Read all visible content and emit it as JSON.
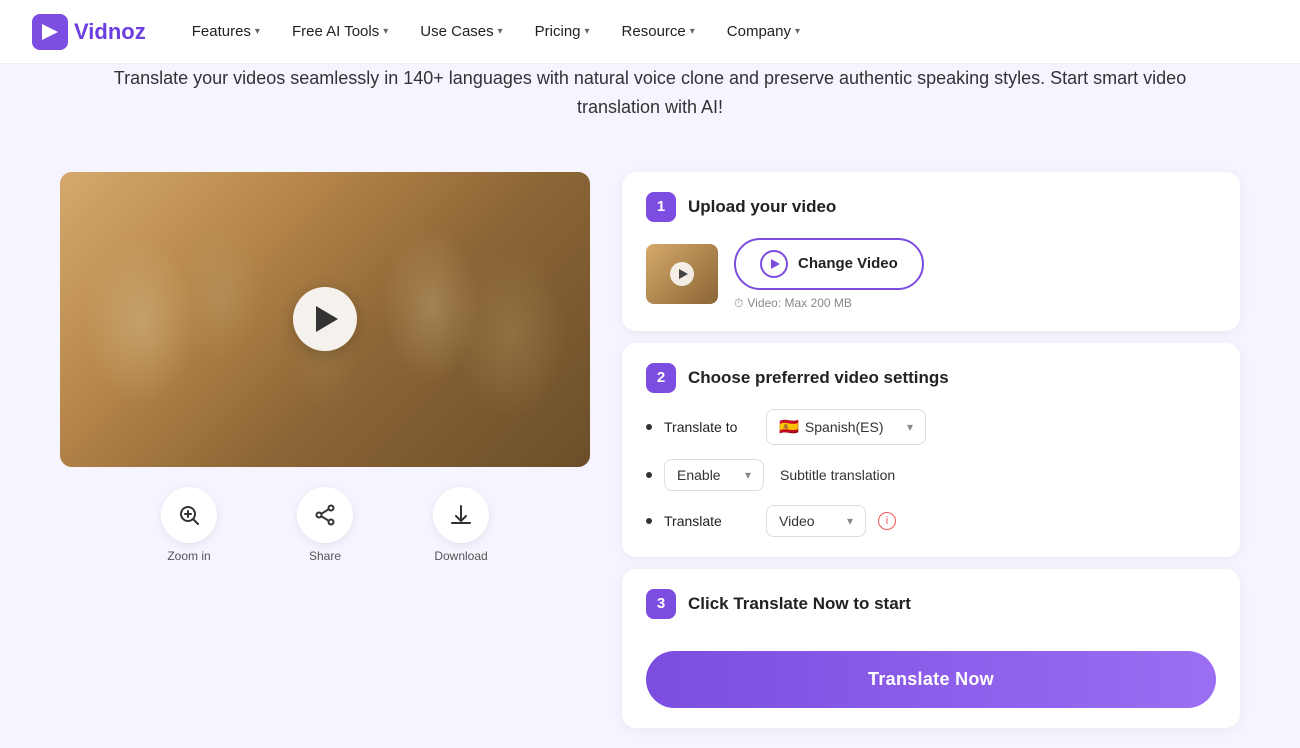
{
  "brand": {
    "name": "Vidnoz",
    "logo_letter": "V"
  },
  "nav": {
    "items": [
      {
        "label": "Features",
        "has_dropdown": true
      },
      {
        "label": "Free AI Tools",
        "has_dropdown": true
      },
      {
        "label": "Use Cases",
        "has_dropdown": true
      },
      {
        "label": "Pricing",
        "has_dropdown": true
      },
      {
        "label": "Resource",
        "has_dropdown": true
      },
      {
        "label": "Company",
        "has_dropdown": true
      }
    ]
  },
  "hero": {
    "subtitle": "Translate your videos seamlessly in 140+ languages with natural voice clone and preserve authentic speaking styles. Start smart video translation with AI!"
  },
  "steps": {
    "step1": {
      "number": "1",
      "title": "Upload your video",
      "change_video_label": "Change Video",
      "video_limit": "Video: Max 200 MB"
    },
    "step2": {
      "number": "2",
      "title": "Choose preferred video settings",
      "translate_to_label": "Translate to",
      "language": "Spanish(ES)",
      "language_flag": "🇪🇸",
      "enable_label": "Enable",
      "subtitle_label": "Subtitle translation",
      "translate_label": "Translate",
      "video_type": "Video"
    },
    "step3": {
      "number": "3",
      "title": "Click Translate Now to start",
      "button_label": "Translate Now"
    }
  },
  "video_controls": {
    "zoom_in": "Zoom in",
    "share": "Share",
    "download": "Download"
  },
  "icons": {
    "play": "▶",
    "chevron_down": "▾",
    "info": "i",
    "zoom": "🔍",
    "share": "⤢",
    "download": "⬇"
  }
}
